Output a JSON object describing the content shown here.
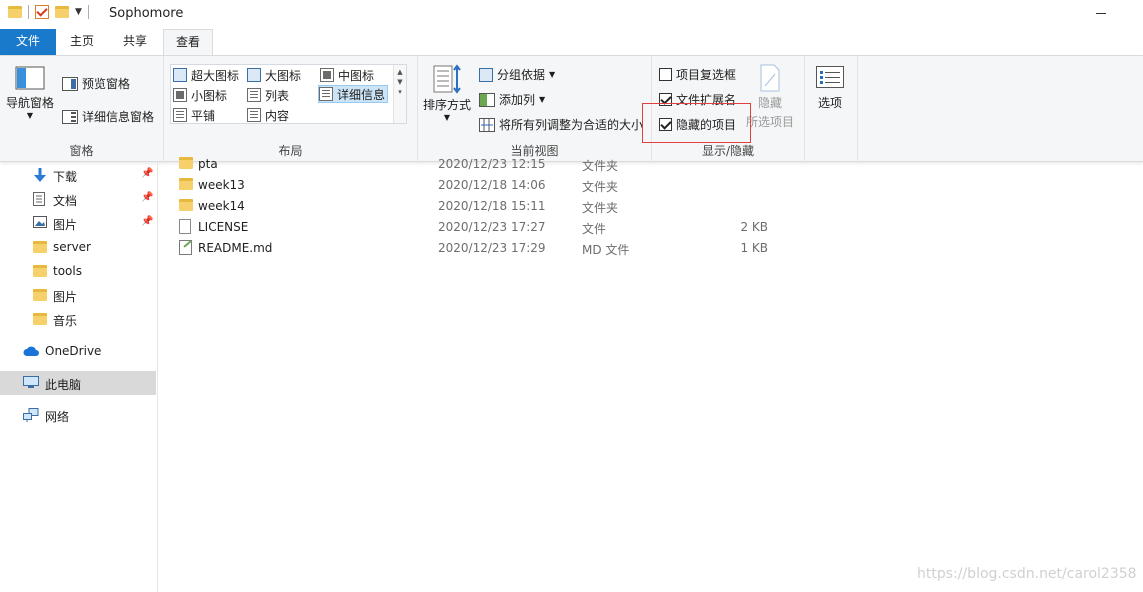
{
  "window": {
    "title": "Sophomore"
  },
  "tabs": {
    "file": "文件",
    "home": "主页",
    "share": "共享",
    "view": "查看"
  },
  "ribbon": {
    "panes": {
      "label": "窗格",
      "nav_pane": "导航窗格",
      "preview_pane": "预览窗格",
      "details_pane": "详细信息窗格"
    },
    "layout": {
      "label": "布局",
      "items": [
        "超大图标",
        "大图标",
        "中图标",
        "小图标",
        "列表",
        "详细信息",
        "平铺",
        "内容"
      ],
      "selected": "详细信息"
    },
    "current_view": {
      "label": "当前视图",
      "sort_by": "排序方式",
      "group_by": "分组依据",
      "add_columns": "添加列",
      "size_all_columns": "将所有列调整为合适的大小"
    },
    "show_hide": {
      "label": "显示/隐藏",
      "item_checkboxes": "项目复选框",
      "file_extensions": "文件扩展名",
      "hidden_items": "隐藏的项目",
      "item_checkboxes_checked": false,
      "file_extensions_checked": true,
      "hidden_items_checked": true,
      "hide_selected_line1": "隐藏",
      "hide_selected_line2": "所选项目"
    },
    "options": "选项"
  },
  "nav": {
    "quick": [
      {
        "label": "下载",
        "icon": "download-icon",
        "pinned": true
      },
      {
        "label": "文档",
        "icon": "document-icon",
        "pinned": true
      },
      {
        "label": "图片",
        "icon": "pictures-icon",
        "pinned": true
      },
      {
        "label": "server",
        "icon": "folder-icon",
        "pinned": false
      },
      {
        "label": "tools",
        "icon": "folder-icon",
        "pinned": false
      },
      {
        "label": "图片",
        "icon": "folder-icon",
        "pinned": false
      },
      {
        "label": "音乐",
        "icon": "folder-icon",
        "pinned": false
      }
    ],
    "onedrive": "OneDrive",
    "this_pc": "此电脑",
    "network": "网络"
  },
  "files": [
    {
      "name": "pta",
      "date": "2020/12/23 12:15",
      "type": "文件夹",
      "size": "",
      "kind": "folder"
    },
    {
      "name": "week13",
      "date": "2020/12/18 14:06",
      "type": "文件夹",
      "size": "",
      "kind": "folder"
    },
    {
      "name": "week14",
      "date": "2020/12/18 15:11",
      "type": "文件夹",
      "size": "",
      "kind": "folder"
    },
    {
      "name": "LICENSE",
      "date": "2020/12/23 17:27",
      "type": "文件",
      "size": "2 KB",
      "kind": "file"
    },
    {
      "name": "README.md",
      "date": "2020/12/23 17:29",
      "type": "MD 文件",
      "size": "1 KB",
      "kind": "md"
    }
  ],
  "watermark": "https://blog.csdn.net/carol2358",
  "colors": {
    "accent": "#1979ca",
    "selected_layout": "#cce4f7",
    "highlight_box": "#e04040"
  }
}
